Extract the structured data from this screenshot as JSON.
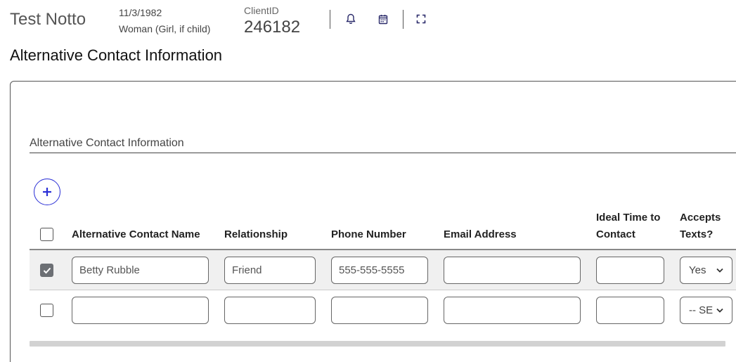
{
  "client": {
    "name": "Test Notto",
    "dob": "11/3/1982",
    "gender": "Woman (Girl, if child)",
    "id_label": "ClientID",
    "id_value": "246182"
  },
  "header_icons": [
    "bell-icon",
    "calendar-icon",
    "fullscreen-icon"
  ],
  "page_title": "Alternative Contact Information",
  "section": {
    "title": "Alternative Contact Information",
    "add_icon": "plus-icon"
  },
  "table": {
    "columns": [
      "Alternative Contact Name",
      "Relationship",
      "Phone Number",
      "Email Address",
      "Ideal Time to Contact",
      "Accepts Texts?"
    ],
    "rows": [
      {
        "selected": true,
        "name": "Betty  Rubble",
        "relationship": "Friend",
        "phone": "555-555-5555",
        "email": "",
        "ideal_time": "",
        "accepts_texts": "Yes"
      },
      {
        "selected": false,
        "name": "",
        "relationship": "",
        "phone": "",
        "email": "",
        "ideal_time": "",
        "accepts_texts": "-- SE"
      }
    ]
  },
  "colors": {
    "accent": "#2a2fd6",
    "checked": "#6c6f74",
    "selected_row_bg": "#f0f0f0"
  }
}
